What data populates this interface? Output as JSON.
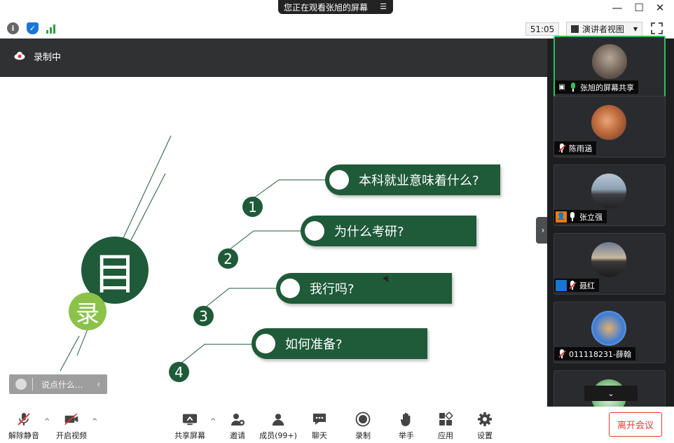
{
  "banner": {
    "text": "您正在观看张旭的屏幕",
    "menu_glyph": "☰"
  },
  "window": {
    "minimize": "—",
    "maximize": "☐",
    "close": "✕"
  },
  "toolbar": {
    "info_icon": "i",
    "timer": "51:05",
    "view_mode": "演讲者视图"
  },
  "recording": {
    "label": "录制中"
  },
  "slide": {
    "title_char_1": "目",
    "title_char_2": "录",
    "items": [
      {
        "num": "1",
        "text": "本科就业意味着什么?"
      },
      {
        "num": "2",
        "text": "为什么考研?"
      },
      {
        "num": "3",
        "text": "我行吗?"
      },
      {
        "num": "4",
        "text": "如何准备?"
      }
    ],
    "colors": {
      "dark_green": "#1f5a39",
      "light_green": "#8bc34a"
    }
  },
  "chat_input": {
    "placeholder": "说点什么..."
  },
  "participants": [
    {
      "name": "张旭的屏幕共享",
      "sharing": true,
      "muted": false
    },
    {
      "name": "陈雨涵",
      "muted": true
    },
    {
      "name": "张立强",
      "muted": false
    },
    {
      "name": "聂红",
      "muted": true
    },
    {
      "name": "011118231-薛翰",
      "muted": true
    },
    {
      "name": "",
      "muted": true
    }
  ],
  "controls": {
    "unmute": "解除静音",
    "start_video": "开启视频",
    "share_screen": "共享屏幕",
    "invite": "邀请",
    "members": "成员(99+)",
    "chat": "聊天",
    "record": "录制",
    "raise_hand": "举手",
    "apps": "应用",
    "settings": "设置",
    "leave": "离开会议"
  }
}
